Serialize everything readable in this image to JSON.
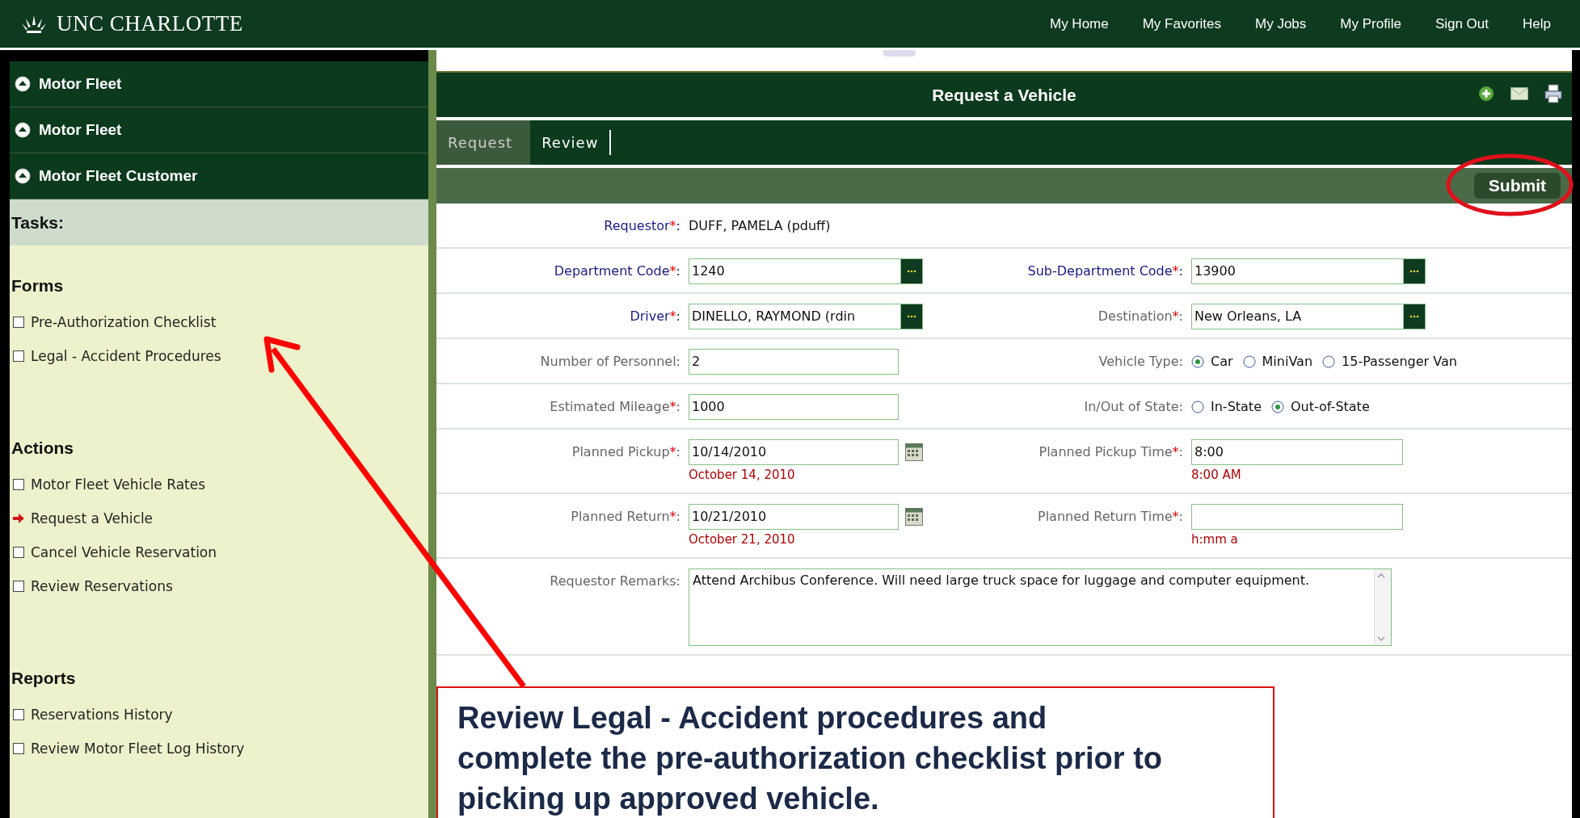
{
  "header": {
    "logo_text": "UNC CHARLOTTE",
    "nav": [
      "My Home",
      "My Favorites",
      "My Jobs",
      "My Profile",
      "Sign Out",
      "Help"
    ]
  },
  "sidebar": {
    "modules": [
      "Motor Fleet",
      "Motor Fleet",
      "Motor Fleet Customer"
    ],
    "tasks_title": "Tasks:",
    "sections": [
      {
        "title": "Forms",
        "items": [
          {
            "label": "Pre-Authorization Checklist",
            "selected": false
          },
          {
            "label": "Legal - Accident Procedures",
            "selected": false
          }
        ]
      },
      {
        "title": "Actions",
        "items": [
          {
            "label": "Motor Fleet Vehicle Rates",
            "selected": false
          },
          {
            "label": "Request a Vehicle",
            "selected": true
          },
          {
            "label": "Cancel Vehicle Reservation",
            "selected": false
          },
          {
            "label": "Review Reservations",
            "selected": false
          }
        ]
      },
      {
        "title": "Reports",
        "items": [
          {
            "label": "Reservations History",
            "selected": false
          },
          {
            "label": "Review Motor Fleet Log History",
            "selected": false
          }
        ]
      }
    ]
  },
  "panel": {
    "title": "Request a Vehicle",
    "tabs": [
      {
        "label": "Request",
        "selected": true
      },
      {
        "label": "Review",
        "selected": false
      }
    ],
    "submit": "Submit",
    "rows": [
      {
        "fields": [
          {
            "kind": "static",
            "label": "Requestor",
            "mark": "*",
            "colon": ":",
            "highlighted": true,
            "value": "DUFF, PAMELA (pduff)"
          }
        ]
      },
      {
        "fields": [
          {
            "kind": "lookup",
            "label": "Department Code",
            "mark": "*",
            "colon": ":",
            "highlighted": true,
            "value": "1240"
          },
          {
            "kind": "lookup",
            "label": "Sub-Department Code",
            "mark": "*",
            "colon": ":",
            "highlighted": true,
            "value": "13900"
          }
        ]
      },
      {
        "fields": [
          {
            "kind": "lookup",
            "label": "Driver",
            "mark": "*",
            "colon": ":",
            "highlighted": true,
            "value": "DINELLO, RAYMOND (rdin"
          },
          {
            "kind": "lookup",
            "label": "Destination",
            "mark": "*",
            "colon": ":",
            "highlighted": false,
            "value": "New Orleans, LA"
          }
        ]
      },
      {
        "fields": [
          {
            "kind": "text",
            "label": "Number of Personnel",
            "colon": ":",
            "highlighted": false,
            "value": "2"
          },
          {
            "kind": "radio",
            "label": "Vehicle Type",
            "colon": ":",
            "highlighted": false,
            "options": [
              {
                "label": "Car",
                "selected": true
              },
              {
                "label": "MiniVan",
                "selected": false
              },
              {
                "label": "15-Passenger Van",
                "selected": false
              }
            ]
          }
        ]
      },
      {
        "fields": [
          {
            "kind": "text",
            "label": "Estimated Mileage",
            "mark": "*",
            "colon": ":",
            "highlighted": false,
            "value": "1000"
          },
          {
            "kind": "radio",
            "label": "In/Out of State",
            "colon": ":",
            "highlighted": false,
            "options": [
              {
                "label": "In-State",
                "selected": false
              },
              {
                "label": "Out-of-State",
                "selected": true
              }
            ]
          }
        ]
      },
      {
        "fields": [
          {
            "kind": "date",
            "label": "Planned Pickup",
            "mark": "*",
            "colon": ":",
            "highlighted": false,
            "value": "10/14/2010",
            "hint": "October 14, 2010"
          },
          {
            "kind": "wide",
            "label": "Planned Pickup Time",
            "mark": "*",
            "colon": ":",
            "highlighted": false,
            "value": "8:00",
            "hint": "8:00 AM"
          }
        ]
      },
      {
        "fields": [
          {
            "kind": "date",
            "label": "Planned Return",
            "mark": "*",
            "colon": ":",
            "highlighted": false,
            "value": "10/21/2010",
            "hint": "October 21, 2010"
          },
          {
            "kind": "wide",
            "label": "Planned Return Time",
            "mark": "*",
            "colon": ":",
            "highlighted": false,
            "hint": "h:mm a"
          }
        ]
      },
      {
        "fields": [
          {
            "kind": "textarea",
            "label": "Requestor Remarks",
            "colon": ":",
            "highlighted": false,
            "value": "Attend Archibus Conference. Will need large truck space for luggage and computer equipment."
          }
        ]
      }
    ]
  },
  "callout": {
    "text": "Review Legal - Accident procedures and\ncomplete the pre-authorization checklist prior to\npicking up approved vehicle."
  }
}
